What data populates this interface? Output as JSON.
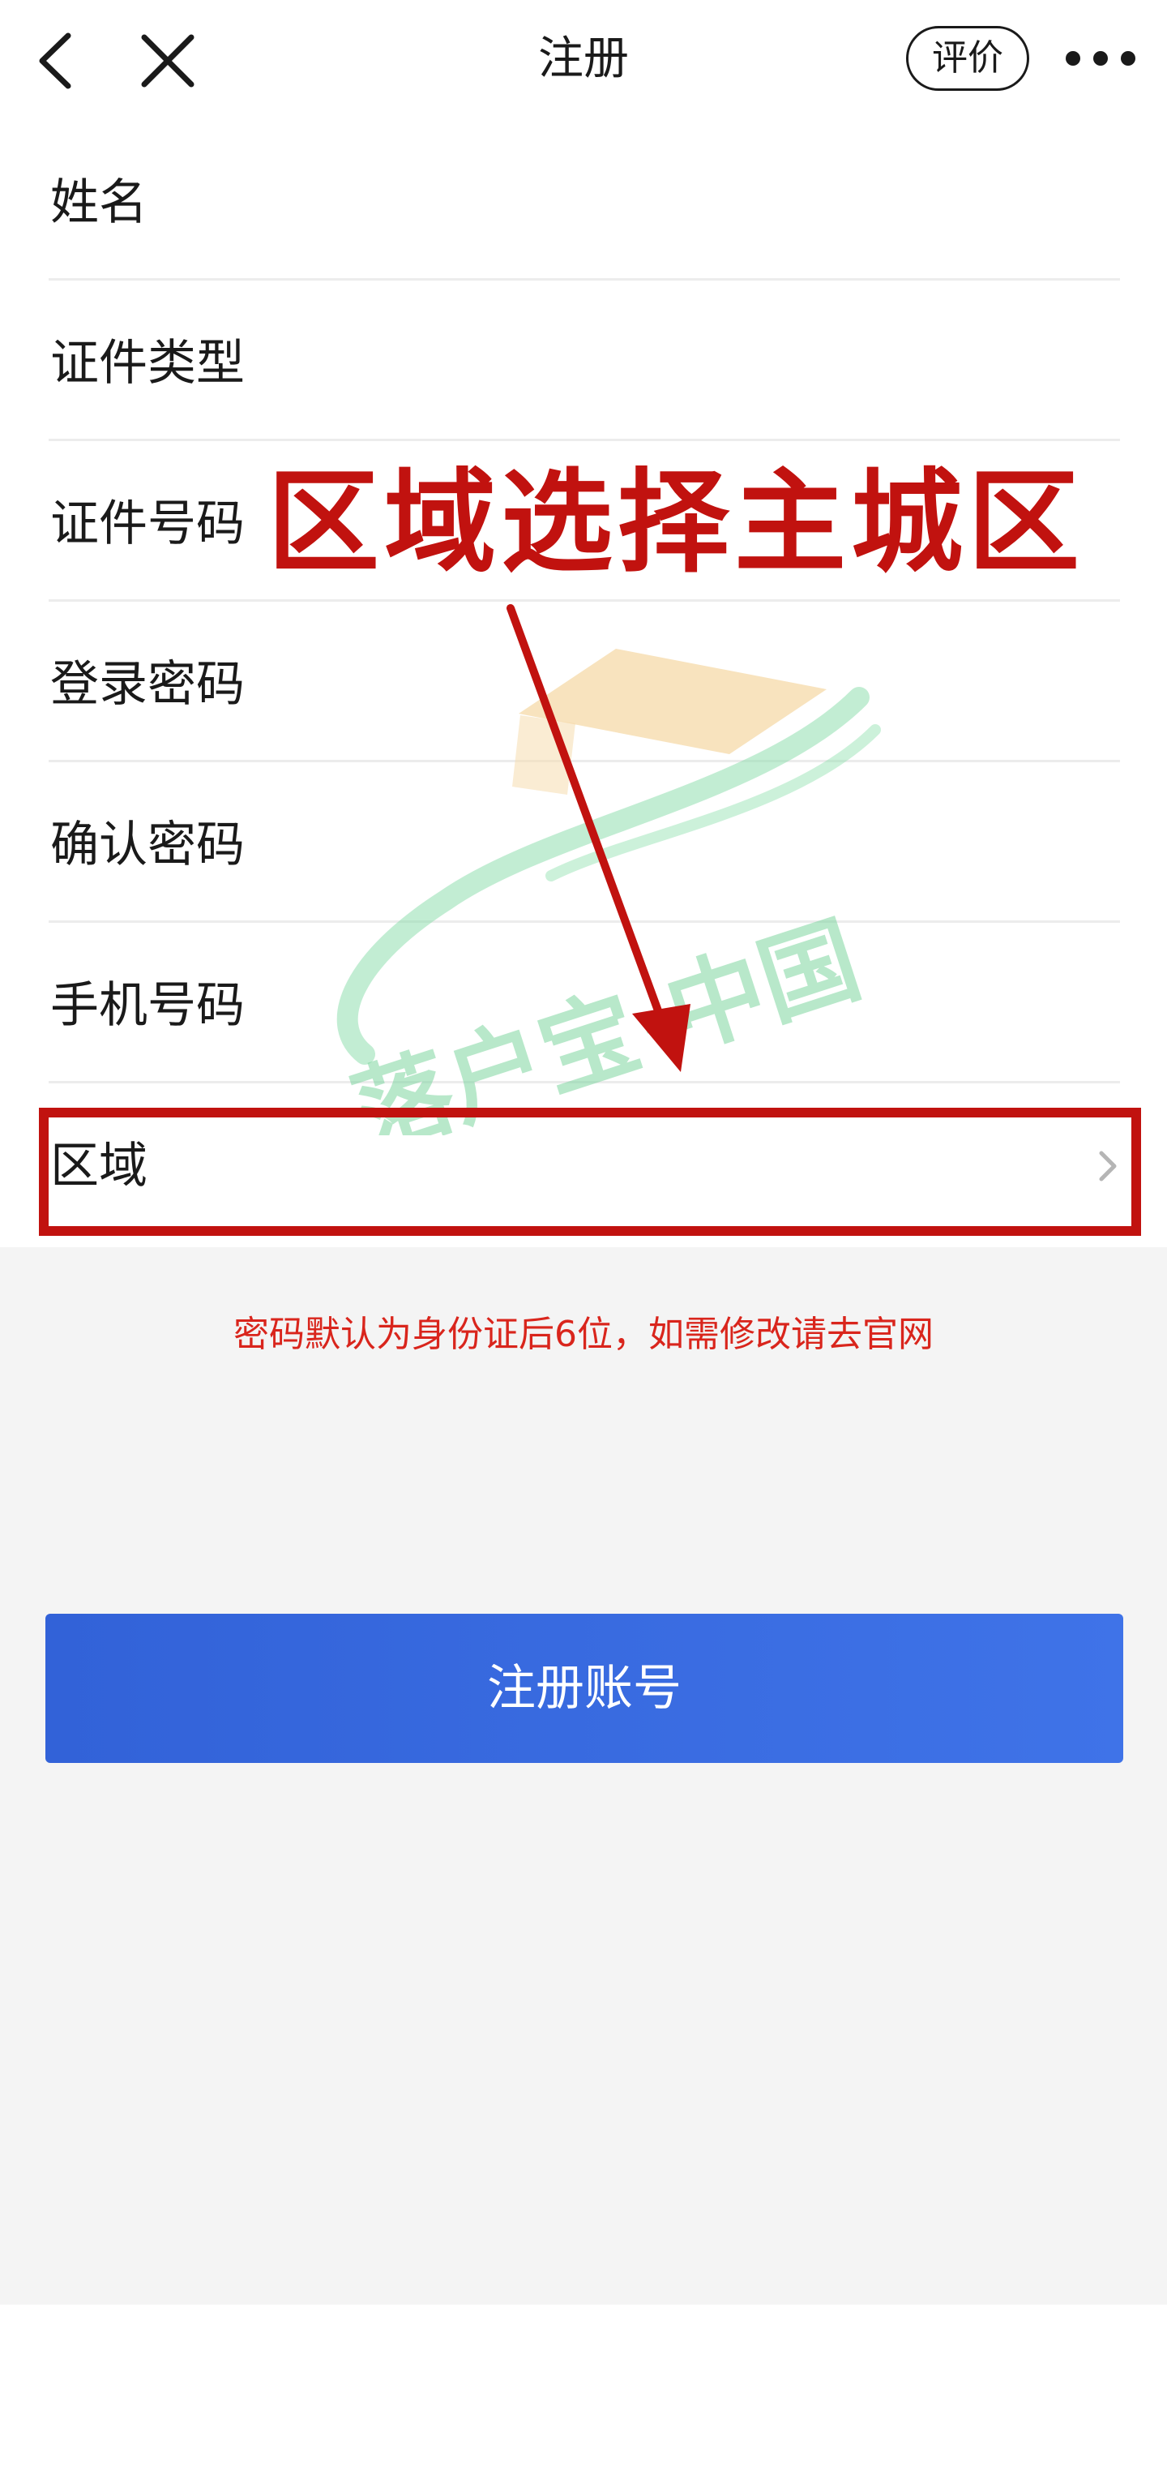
{
  "nav": {
    "title": "注册",
    "rate_label": "评价",
    "icons": [
      "back-arrow-icon",
      "close-icon",
      "more-dots-icon"
    ]
  },
  "form": {
    "fields": [
      {
        "label": "姓名"
      },
      {
        "label": "证件类型"
      },
      {
        "label": "证件号码"
      },
      {
        "label": "登录密码"
      },
      {
        "label": "确认密码"
      },
      {
        "label": "手机号码"
      },
      {
        "label": "区域"
      }
    ]
  },
  "hint": "密码默认为身份证后6位，如需修改请去官网",
  "submit_label": "注册账号",
  "annotation": {
    "text": "区域选择主城区",
    "color": "#c1120f"
  },
  "watermark": {
    "text": "落户宝·中国",
    "color": "#7fd6a0"
  },
  "colors": {
    "accent": "#3f73e8",
    "hint": "#d9251c"
  }
}
